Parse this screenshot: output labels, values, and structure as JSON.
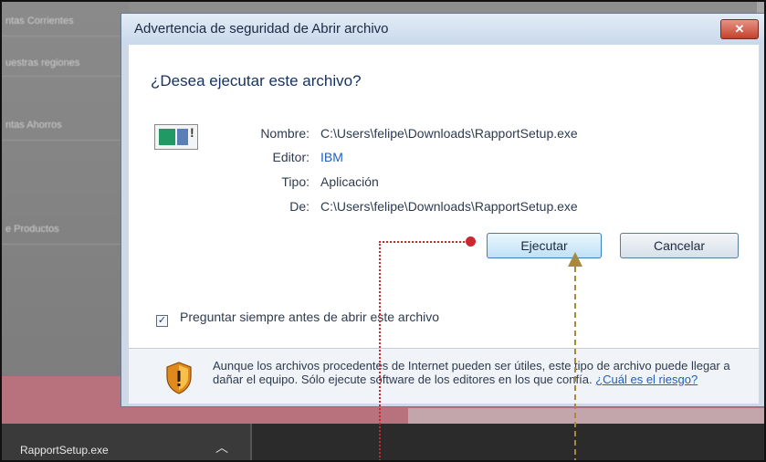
{
  "background": {
    "sidebar_items": [
      "ntas Corrientes",
      "uestras regiones",
      "ntas Ahorros",
      "e Productos"
    ]
  },
  "dialog": {
    "title": "Advertencia de seguridad de Abrir archivo",
    "close_label": "✕",
    "question": "¿Desea ejecutar este archivo?",
    "fields": [
      {
        "label": "Nombre:",
        "value": "C:\\Users\\felipe\\Downloads\\RapportSetup.exe",
        "link": false
      },
      {
        "label": "Editor:",
        "value": "IBM",
        "link": true
      },
      {
        "label": "Tipo:",
        "value": "Aplicación",
        "link": false
      },
      {
        "label": "De:",
        "value": "C:\\Users\\felipe\\Downloads\\RapportSetup.exe",
        "link": false
      }
    ],
    "run_button": "Ejecutar",
    "cancel_button": "Cancelar",
    "checkbox_label": "Preguntar siempre antes de abrir este archivo",
    "checkbox_checked": true,
    "warning_text": "Aunque los archivos procedentes de Internet pueden ser útiles, este tipo de archivo puede llegar a dañar el equipo. Sólo ejecute software de los editores en los que confía.",
    "risk_link": "¿Cuál es el riesgo?"
  },
  "download_bar": {
    "file_name": "RapportSetup.exe",
    "chevron_icon": "chevron-up-icon"
  },
  "colors": {
    "guide_red": "#d0262f",
    "guide_gold": "#a88a3a",
    "link_blue": "#1e5fbf"
  }
}
